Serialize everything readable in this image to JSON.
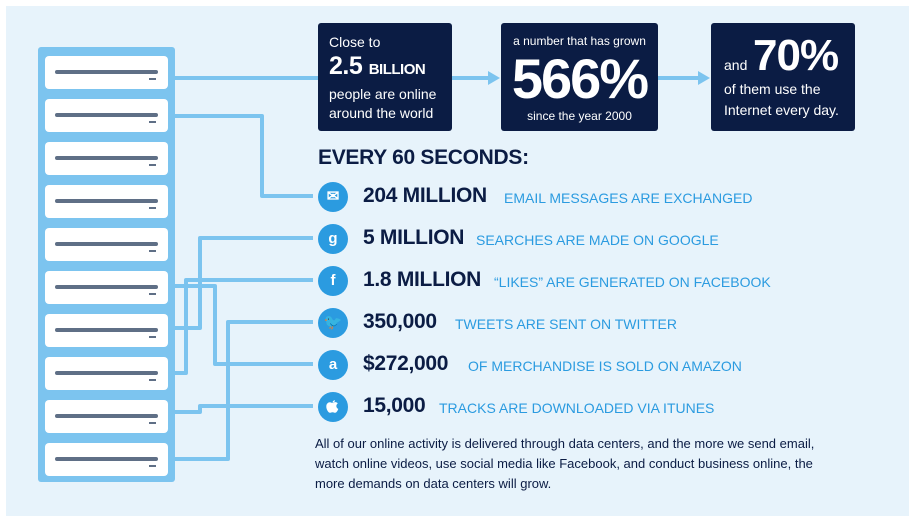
{
  "stat_box_1": {
    "lead": "Close to",
    "number": "2.5",
    "unit": "BILLION",
    "line1": "people are online",
    "line2": "around the world"
  },
  "stat_box_2": {
    "lead": "a number that has grown",
    "number": "566%",
    "tail": "since the year 2000"
  },
  "stat_box_3": {
    "lead": "and",
    "number": "70%",
    "line1": "of them use the",
    "line2": "Internet every day."
  },
  "heading": "EVERY 60 SECONDS:",
  "stats": [
    {
      "icon": "email-icon",
      "glyph": "✉",
      "value": "204 MILLION",
      "text": "EMAIL MESSAGES ARE EXCHANGED"
    },
    {
      "icon": "google-icon",
      "glyph": "g",
      "value": "5 MILLION",
      "text": "SEARCHES ARE MADE ON GOOGLE"
    },
    {
      "icon": "facebook-icon",
      "glyph": "f",
      "value": "1.8 MILLION",
      "text": "“LIKES” ARE GENERATED ON FACEBOOK"
    },
    {
      "icon": "twitter-icon",
      "glyph": "🐦",
      "value": "350,000",
      "text": "TWEETS ARE SENT ON TWITTER"
    },
    {
      "icon": "amazon-icon",
      "glyph": "a",
      "value": "$272,000",
      "text": "OF MERCHANDISE IS SOLD ON AMAZON"
    },
    {
      "icon": "apple-icon",
      "glyph": "",
      "value": "15,000",
      "text": "TRACKS ARE DOWNLOADED VIA ITUNES"
    }
  ],
  "footer": "All of our online activity is delivered through data centers, and the more we send email, watch online videos, use social media like Facebook, and conduct business online, the more demands on data centers will grow.",
  "colors": {
    "navy": "#0b1c44",
    "accent_blue": "#2b9be0",
    "light_blue": "#7cc4ef",
    "background": "#e7f3fb"
  }
}
